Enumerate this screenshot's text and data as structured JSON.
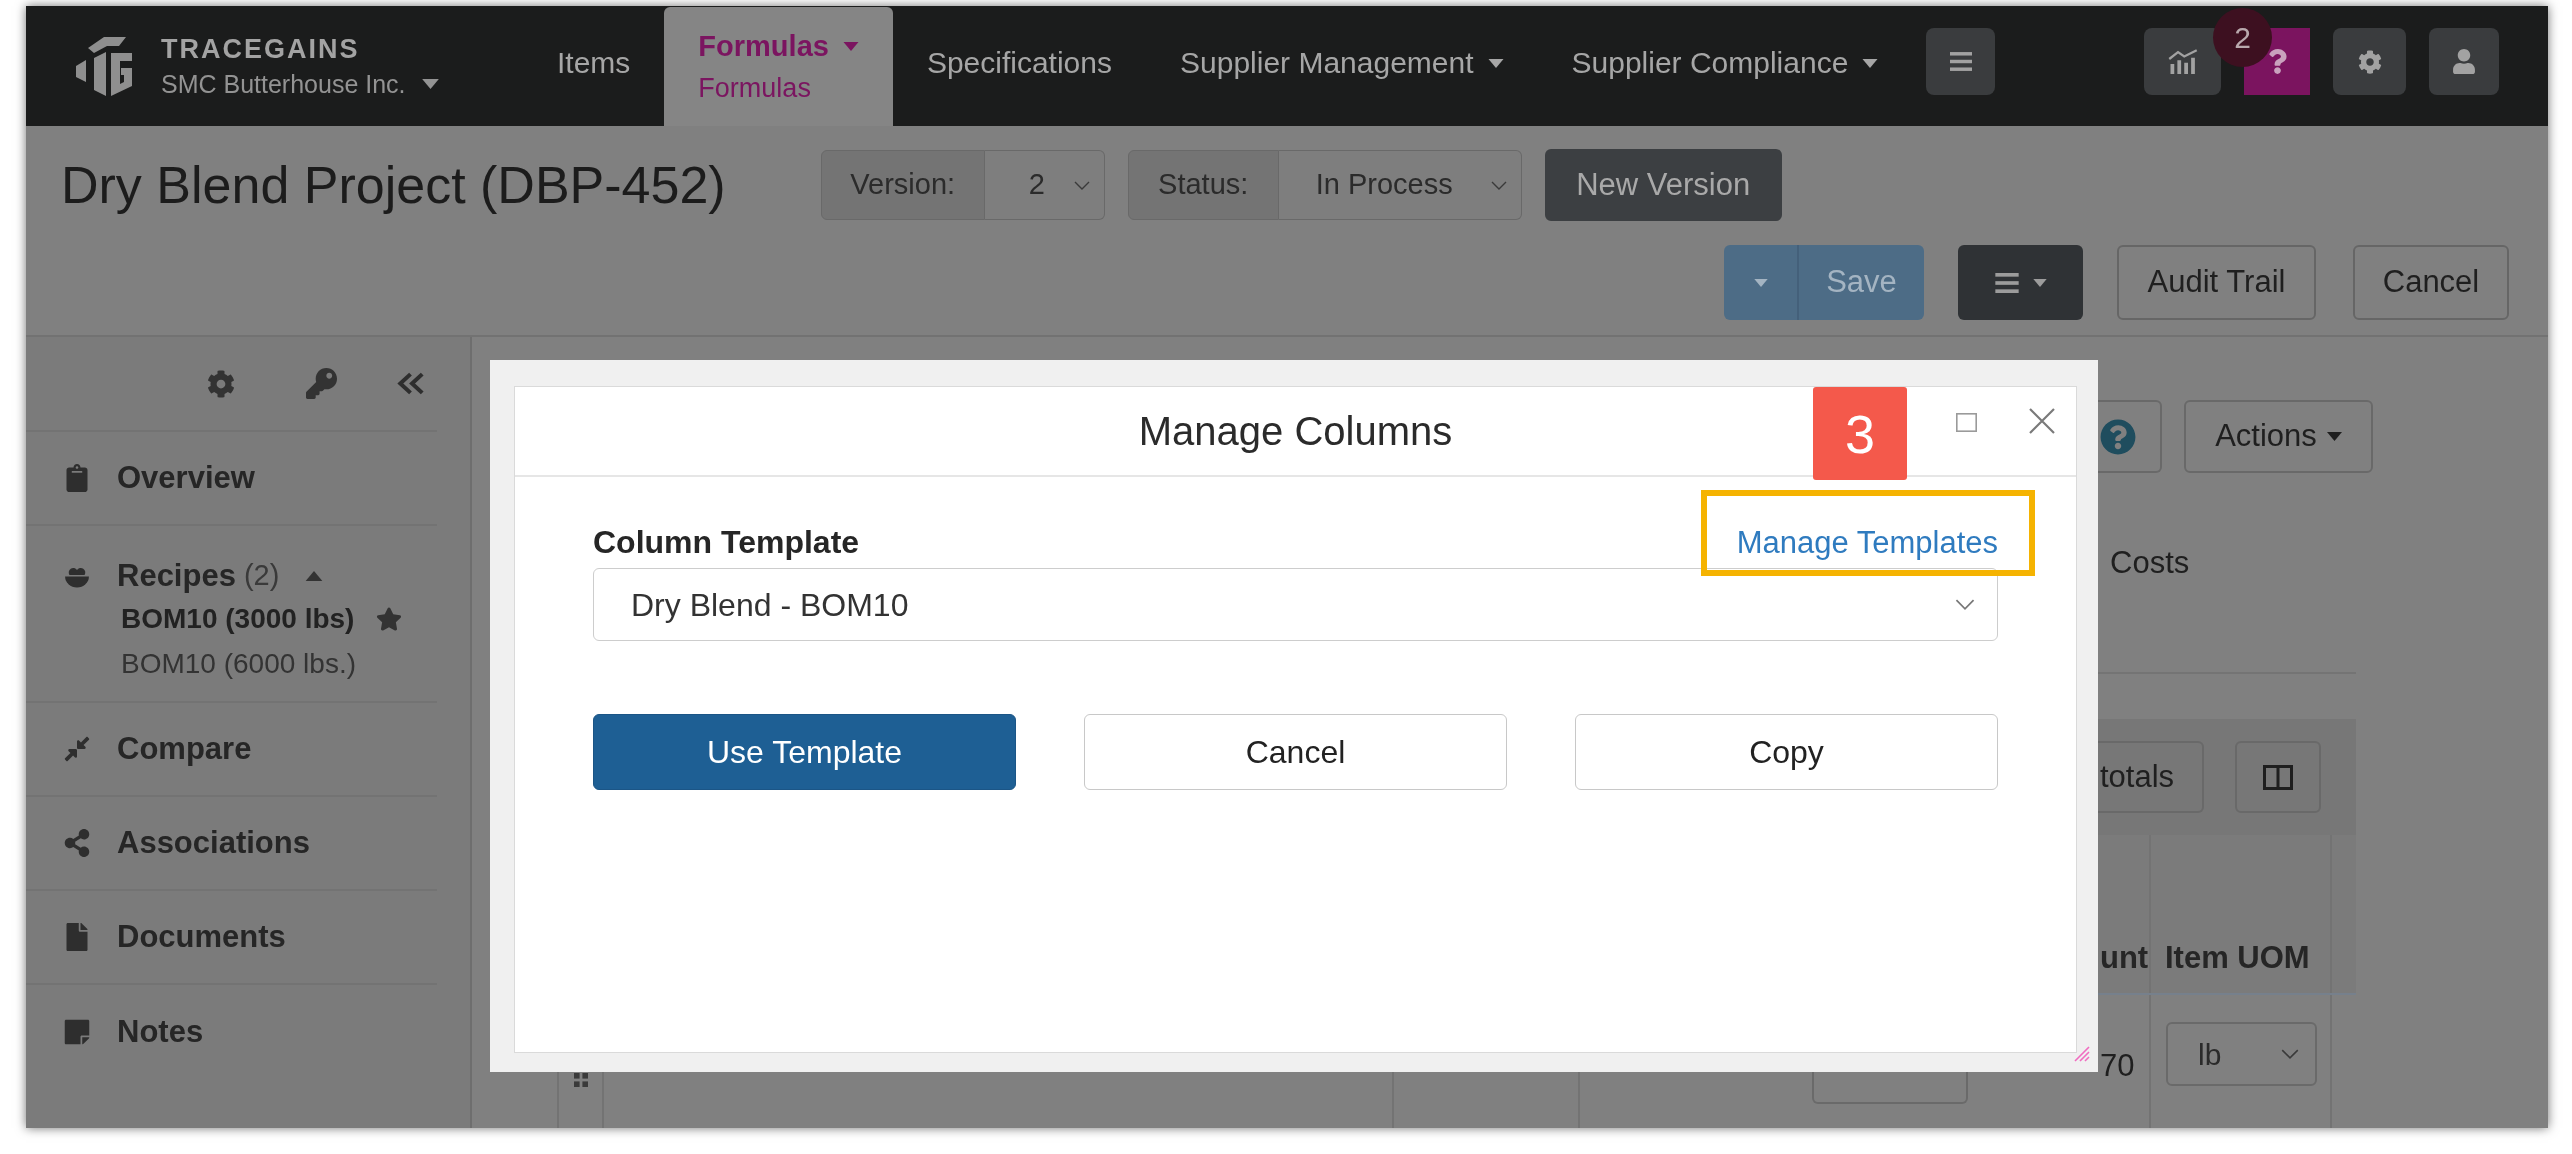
{
  "top_nav": {
    "brand": "TRACEGAINS",
    "company": "SMC Butterhouse Inc.",
    "items": [
      {
        "label": "Items",
        "selected": false,
        "dropdown": false
      },
      {
        "label": "Formulas",
        "selected": true,
        "dropdown": true,
        "sub_label": "Formulas"
      },
      {
        "label": "Specifications",
        "selected": false,
        "dropdown": false
      },
      {
        "label": "Supplier Management",
        "selected": false,
        "dropdown": true
      },
      {
        "label": "Supplier Compliance",
        "selected": false,
        "dropdown": true
      }
    ],
    "help_badge": "2"
  },
  "header": {
    "title": "Dry Blend Project (DBP-452)",
    "version": {
      "label": "Version:",
      "value": "2"
    },
    "status": {
      "label": "Status:",
      "value": "In Process"
    },
    "new_version_button": "New Version",
    "save_button": "Save",
    "audit_trail_button": "Audit Trail",
    "cancel_button": "Cancel"
  },
  "sidebar": {
    "items": [
      {
        "label": "Overview"
      },
      {
        "label": "Recipes",
        "count": "(2)",
        "expanded": true,
        "children": [
          {
            "label": "BOM10 (3000 lbs)",
            "selected": true,
            "default": true
          },
          {
            "label": "BOM10 (6000 lbs.)",
            "selected": false,
            "default": false
          }
        ]
      },
      {
        "label": "Compare"
      },
      {
        "label": "Associations"
      },
      {
        "label": "Documents"
      },
      {
        "label": "Notes"
      }
    ]
  },
  "content": {
    "actions_button": "Actions",
    "section_title": "Costs",
    "toolbar_button": "totals",
    "table": {
      "columns": [
        "unt",
        "Item UOM"
      ],
      "rows": [
        {
          "amount": "70",
          "uom": "lb"
        }
      ]
    }
  },
  "modal": {
    "title": "Manage Columns",
    "step_badge": "3",
    "field_label": "Column Template",
    "link": {
      "label": "Manage Templates",
      "highlighted": true
    },
    "template_value": "Dry Blend - BOM10",
    "buttons": [
      {
        "label": "Use Template",
        "kind": "primary"
      },
      {
        "label": "Cancel",
        "kind": "secondary"
      },
      {
        "label": "Copy",
        "kind": "secondary"
      }
    ]
  }
}
